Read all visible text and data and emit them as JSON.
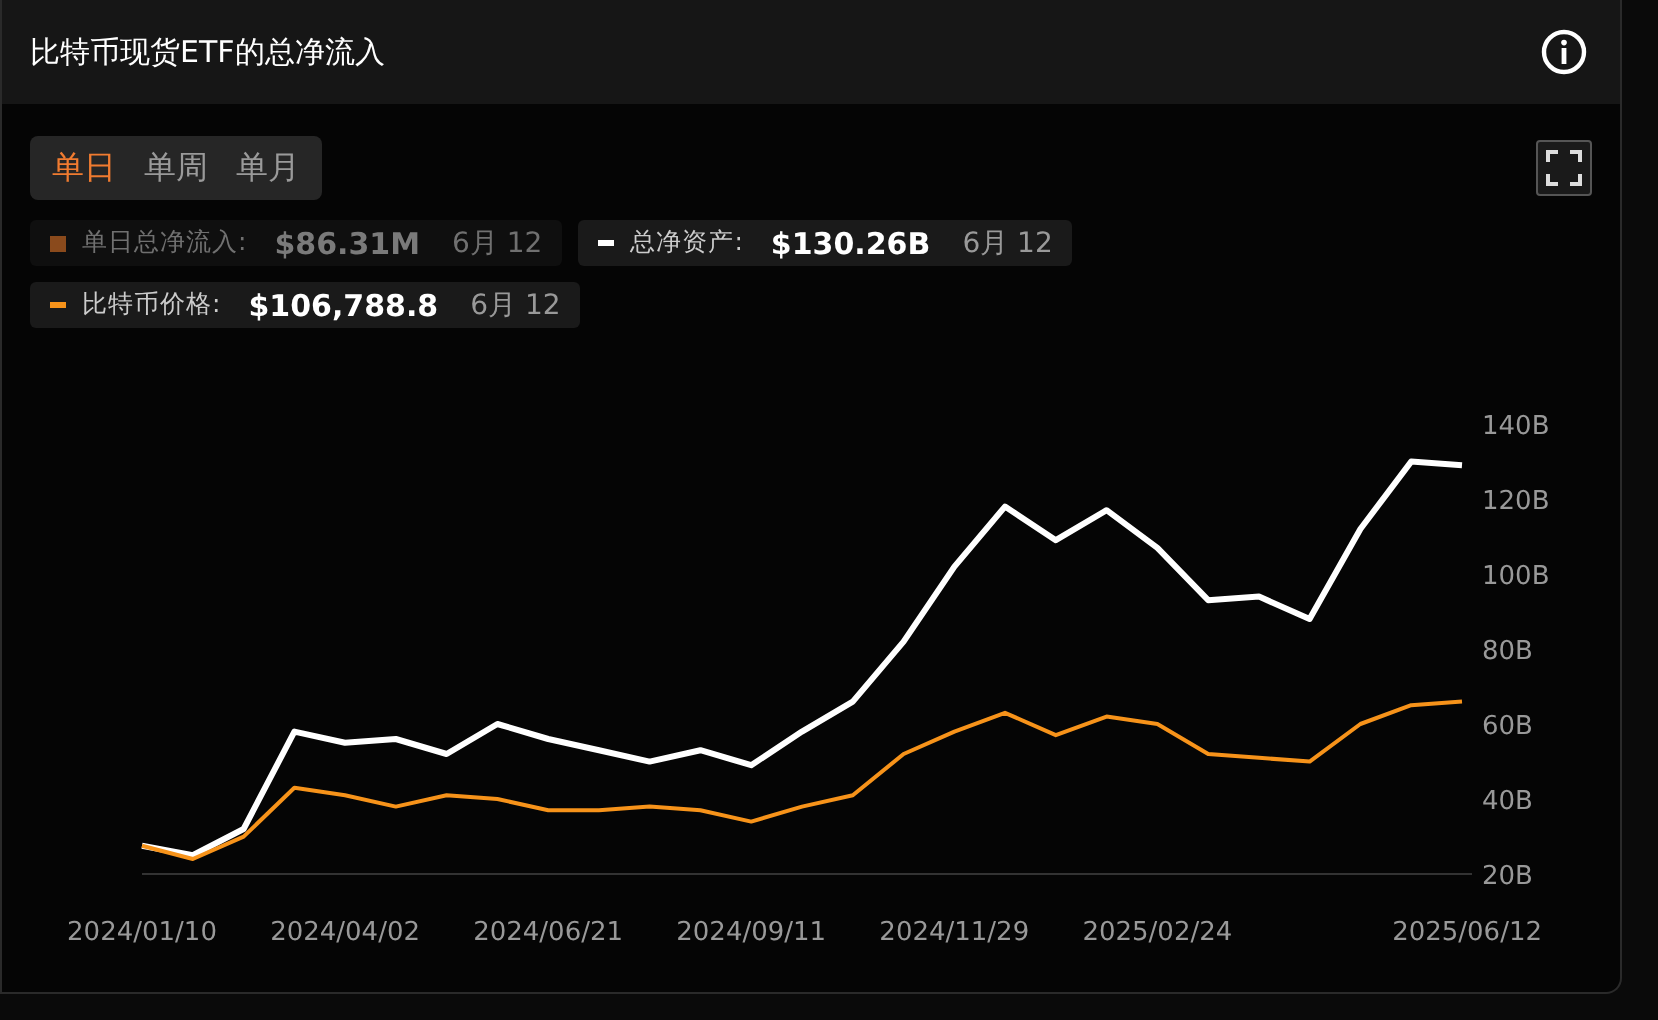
{
  "header": {
    "title": "比特币现货ETF的总净流入"
  },
  "tabs": [
    {
      "label": "单日",
      "selected": true
    },
    {
      "label": "单周",
      "selected": false
    },
    {
      "label": "单月",
      "selected": false
    }
  ],
  "legend": [
    {
      "label": "单日总净流入:",
      "value": "$86.31M",
      "date": "6月 12",
      "color": "#8a4a1c",
      "active": false
    },
    {
      "label": "总净资产:",
      "value": "$130.26B",
      "date": "6月 12",
      "color": "#ffffff",
      "active": true
    },
    {
      "label": "比特币价格:",
      "value": "$106,788.8",
      "date": "6月 12",
      "color": "#f7931a",
      "active": true
    }
  ],
  "chart_data": {
    "type": "line",
    "categories": [
      "2024/01/10",
      null,
      null,
      null,
      "2024/04/02",
      null,
      null,
      null,
      "2024/06/21",
      null,
      null,
      null,
      "2024/09/11",
      null,
      null,
      null,
      "2024/11/29",
      null,
      null,
      null,
      "2025/02/24",
      null,
      null,
      null,
      null,
      null,
      "2025/06/12"
    ],
    "series": [
      {
        "color": "#ffffff",
        "values": [
          27.5,
          25,
          32,
          58,
          55,
          56,
          52,
          60,
          56,
          53,
          50,
          53,
          49,
          58,
          66,
          82,
          102,
          118,
          109,
          117,
          107,
          93,
          94,
          88,
          112,
          130,
          129
        ]
      },
      {
        "color": "#f7931a",
        "values": [
          27.5,
          24,
          30,
          43,
          41,
          38,
          41,
          40,
          37,
          37,
          38,
          37,
          34,
          38,
          41,
          52,
          58,
          63,
          57,
          62,
          60,
          52,
          51,
          50,
          60,
          65,
          66
        ]
      }
    ],
    "ylim": [
      20,
      140
    ],
    "yticks": [
      {
        "value": 20,
        "label": "20B"
      },
      {
        "value": 40,
        "label": "40B"
      },
      {
        "value": 60,
        "label": "60B"
      },
      {
        "value": 80,
        "label": "80B"
      },
      {
        "value": 100,
        "label": "100B"
      },
      {
        "value": 120,
        "label": "120B"
      },
      {
        "value": 140,
        "label": "140B"
      }
    ]
  }
}
